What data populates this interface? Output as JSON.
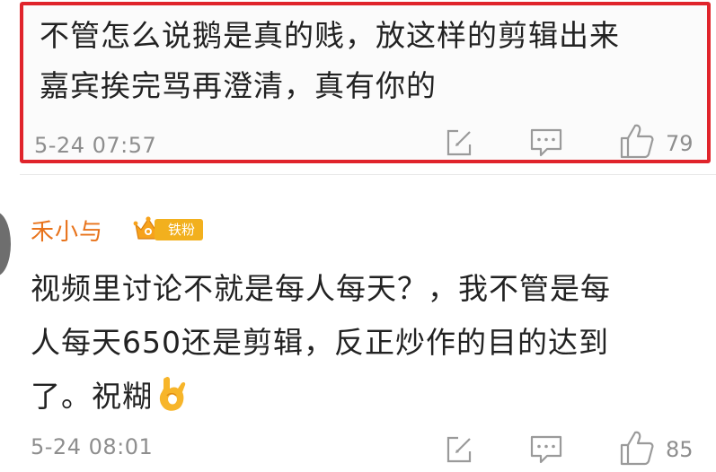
{
  "comments": [
    {
      "lines": [
        "不管怎么说鹅是真的贱，放这样的剪辑出来",
        "嘉宾挨完骂再澄清，真有你的"
      ],
      "time": "5-24 07:57",
      "likes": "79",
      "highlighted": true,
      "highlight_color": "#e0242b"
    },
    {
      "user": "禾小与",
      "badge": "铁粉",
      "lines": [
        "视频里讨论不就是每人每天？，我不管是每",
        "人每天650还是剪辑，反正炒作的目的达到",
        "了。祝糊"
      ],
      "emoji": "ok-hand-emoji",
      "time": "5-24 08:01",
      "likes": "85"
    }
  ],
  "colors": {
    "username": "#e8731b",
    "meta": "#8e8e8e",
    "badge": "#f2b01e"
  }
}
